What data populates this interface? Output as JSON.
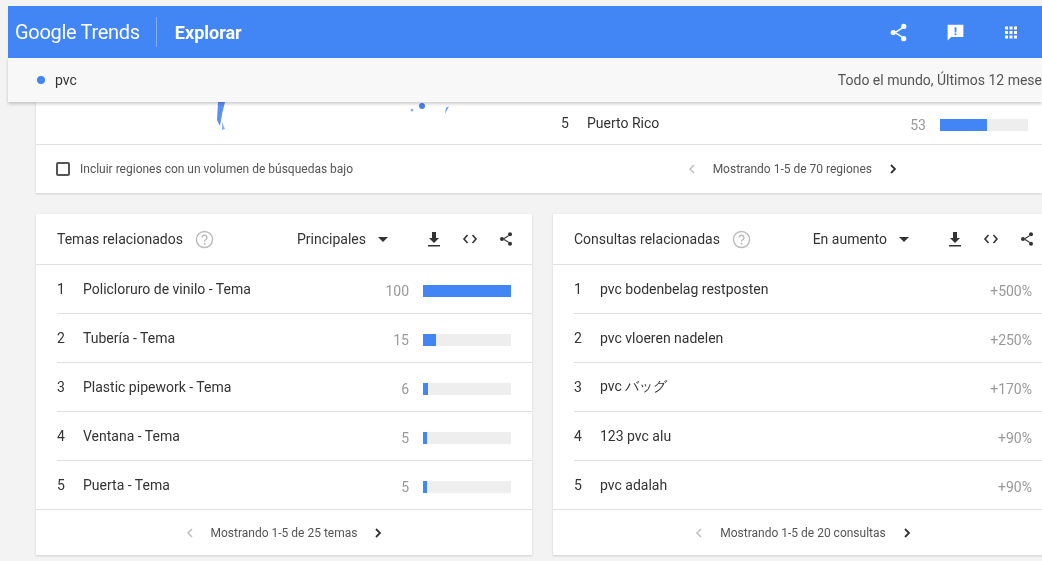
{
  "header": {
    "logo": "Google Trends",
    "title": "Explorar"
  },
  "search_bar": {
    "term": "pvc",
    "color": "#4285f4",
    "scope": "Todo el mundo, Últimos 12 mese"
  },
  "regions": {
    "rows": [
      {
        "rank": "5",
        "name": "Puerto Rico",
        "value": "53",
        "level": 0.53
      }
    ],
    "low_volume_checkbox": {
      "label": "Incluir regiones con un volumen de búsquedas bajo",
      "checked": false
    },
    "pagination": "Mostrando 1-5 de 70 regiones"
  },
  "related_topics": {
    "title": "Temas relacionados",
    "filter": "Principales",
    "rows": [
      {
        "rank": "1",
        "name": "Policloruro de vinilo - Tema",
        "value": "100",
        "level": 1.0
      },
      {
        "rank": "2",
        "name": "Tubería - Tema",
        "value": "15",
        "level": 0.15
      },
      {
        "rank": "3",
        "name": "Plastic pipework - Tema",
        "value": "6",
        "level": 0.06
      },
      {
        "rank": "4",
        "name": "Ventana - Tema",
        "value": "5",
        "level": 0.05
      },
      {
        "rank": "5",
        "name": "Puerta - Tema",
        "value": "5",
        "level": 0.05
      }
    ],
    "pagination": "Mostrando 1-5 de 25 temas"
  },
  "related_queries": {
    "title": "Consultas relacionadas",
    "filter": "En aumento",
    "rows": [
      {
        "rank": "1",
        "name": "pvc bodenbelag restposten",
        "value": "+500%"
      },
      {
        "rank": "2",
        "name": "pvc vloeren nadelen",
        "value": "+250%"
      },
      {
        "rank": "3",
        "name": "pvc バッグ",
        "value": "+170%"
      },
      {
        "rank": "4",
        "name": "123 pvc alu",
        "value": "+90%"
      },
      {
        "rank": "5",
        "name": "pvc adalah",
        "value": "+90%"
      }
    ],
    "pagination": "Mostrando 1-5 de 20 consultas"
  }
}
